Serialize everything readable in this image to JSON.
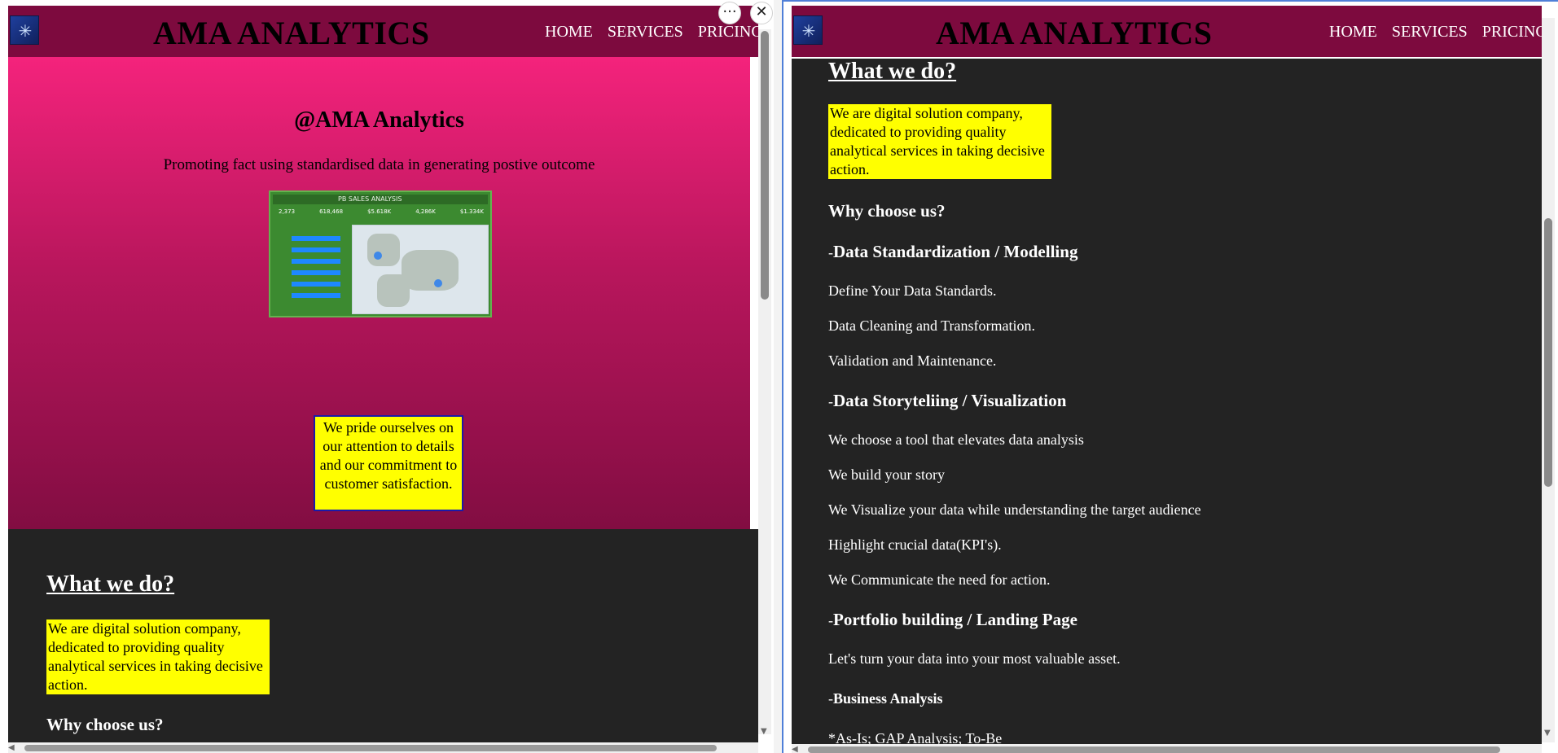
{
  "site": {
    "brand": "AMA ANALYTICS",
    "logo_icon": "snowflake-logo-icon",
    "nav": [
      "HOME",
      "SERVICES",
      "PRICING"
    ]
  },
  "hero": {
    "title": "@AMA Analytics",
    "subtitle": "Promoting fact using standardised data in generating postive outcome",
    "dashboard": {
      "title": "PB SALES ANALYSIS",
      "kpis": [
        "2,373",
        "618,468",
        "$5.618K",
        "4,286K",
        "$1.334K"
      ]
    },
    "callout": "We pride ourselves on our attention to details and our commitment to customer satisfaction."
  },
  "about": {
    "heading": "What we do?",
    "intro": "We are digital solution company, dedicated to providing quality analytical services in taking decisive action.",
    "why": "Why choose us?"
  },
  "services": [
    {
      "prefix": "-",
      "title": "Data Standardization / Modelling",
      "items": [
        "Define Your Data Standards.",
        "Data Cleaning and Transformation.",
        "Validation and Maintenance."
      ]
    },
    {
      "prefix": "-",
      "title": "Data Storyteliing / Visualization",
      "items": [
        "We choose a tool that elevates data analysis",
        "We build your story",
        "We Visualize your data while understanding the target audience",
        "Highlight crucial data(KPI's).",
        "We Communicate the need for action."
      ]
    },
    {
      "prefix": "-",
      "title": "Portfolio building / Landing Page",
      "items": [
        "Let's turn your data into your most valuable asset."
      ]
    },
    {
      "prefix": "-",
      "title": "Business Analysis",
      "items": [
        "*As-Is; GAP Analysis; To-Be"
      ]
    }
  ],
  "controls": {
    "more": "···",
    "close": "✕"
  },
  "scroll": {
    "left_vertical_fraction": 0.0,
    "right_vertical_fraction": 0.35
  }
}
